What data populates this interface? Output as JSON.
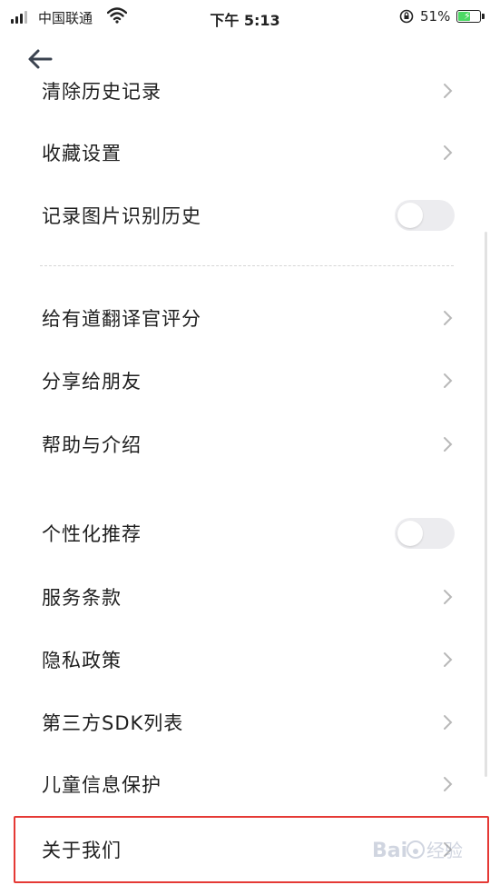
{
  "status_bar": {
    "carrier": "中国联通",
    "time": "下午 5:13",
    "battery_percent": "51%",
    "battery_level": 0.51,
    "icons": [
      "signal-icon",
      "wifi-icon",
      "orientation-lock-icon",
      "battery-charging-icon"
    ]
  },
  "nav": {
    "back_icon": "back-arrow-icon"
  },
  "settings": {
    "partial_item": "清除历史记录",
    "items": [
      {
        "label": "收藏设置",
        "control": "chevron"
      },
      {
        "label": "记录图片识别历史",
        "control": "toggle",
        "on": false
      },
      {
        "label": "给有道翻译官评分",
        "control": "chevron"
      },
      {
        "label": "分享给朋友",
        "control": "chevron"
      },
      {
        "label": "帮助与介绍",
        "control": "chevron"
      },
      {
        "label": "个性化推荐",
        "control": "toggle",
        "on": false
      },
      {
        "label": "服务条款",
        "control": "chevron"
      },
      {
        "label": "隐私政策",
        "control": "chevron"
      },
      {
        "label": "第三方SDK列表",
        "control": "chevron"
      },
      {
        "label": "儿童信息保护",
        "control": "chevron"
      },
      {
        "label": "关于我们",
        "control": "chevron",
        "highlighted": true
      }
    ]
  },
  "colors": {
    "highlight_border": "#e53935",
    "toggle_off": "#ececef",
    "chevron": "#b8b8b8",
    "battery_fill": "#4cd964"
  },
  "watermark": "Baidu 经验"
}
